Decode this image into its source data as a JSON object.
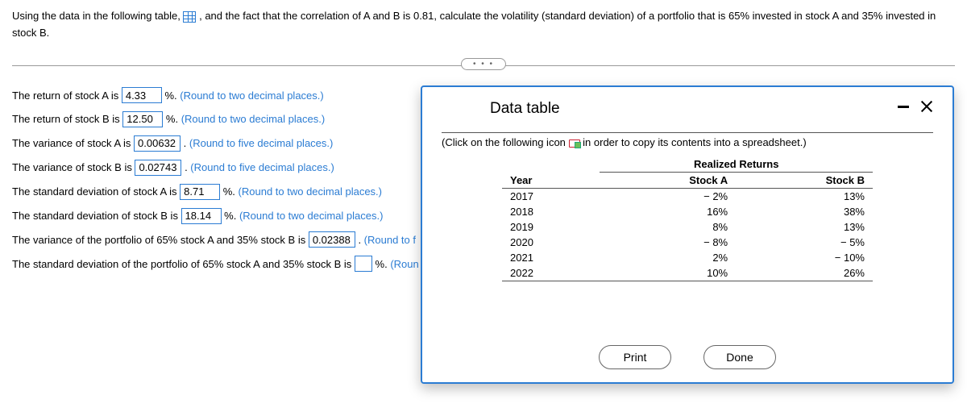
{
  "question": {
    "part1": "Using the data in the following table, ",
    "part2": " , and the fact that the correlation of A and B is 0.81, calculate the volatility (standard deviation) of a portfolio that is 65% invested in stock A and 35% invested in stock B."
  },
  "pill": "• • •",
  "answers": {
    "row1": {
      "pre": "The return of stock A is ",
      "val": "4.33",
      "post": " %.  ",
      "hint": "(Round to two decimal places.)"
    },
    "row2": {
      "pre": "The return of stock B is ",
      "val": "12.50",
      "post": " %.  ",
      "hint": "(Round to two decimal places.)"
    },
    "row3": {
      "pre": "The variance of stock A is ",
      "val": "0.00632",
      "post": " .  ",
      "hint": "(Round to five decimal places.)"
    },
    "row4": {
      "pre": "The variance of stock B is ",
      "val": "0.02743",
      "post": " .  ",
      "hint": "(Round to five decimal places.)"
    },
    "row5": {
      "pre": "The standard deviation of stock A is ",
      "val": "8.71",
      "post": " %.  ",
      "hint": "(Round to two decimal places.)"
    },
    "row6": {
      "pre": "The standard deviation of stock B is ",
      "val": "18.14",
      "post": " %.  ",
      "hint": "(Round to two decimal places.)"
    },
    "row7": {
      "pre": "The variance of the portfolio of 65% stock A and 35% stock B is ",
      "val": "0.02388",
      "post": " .  ",
      "hint": "(Round to f"
    },
    "row8": {
      "pre": "The standard deviation of the portfolio of 65% stock A and 35% stock B is ",
      "val": "",
      "post": " %.  ",
      "hint": "(Roun"
    }
  },
  "modal": {
    "title": "Data table",
    "note_pre": "(Click on the following icon ",
    "note_post": " in order to copy its contents into a spreadsheet.)",
    "span_header": "Realized Returns",
    "headers": {
      "year": "Year",
      "a": "Stock A",
      "b": "Stock B"
    },
    "rows": [
      {
        "year": "2017",
        "a": "− 2%",
        "b": "13%"
      },
      {
        "year": "2018",
        "a": "16%",
        "b": "38%"
      },
      {
        "year": "2019",
        "a": "8%",
        "b": "13%"
      },
      {
        "year": "2020",
        "a": "− 8%",
        "b": "− 5%"
      },
      {
        "year": "2021",
        "a": "2%",
        "b": "− 10%"
      },
      {
        "year": "2022",
        "a": "10%",
        "b": "26%"
      }
    ],
    "print": "Print",
    "done": "Done"
  }
}
